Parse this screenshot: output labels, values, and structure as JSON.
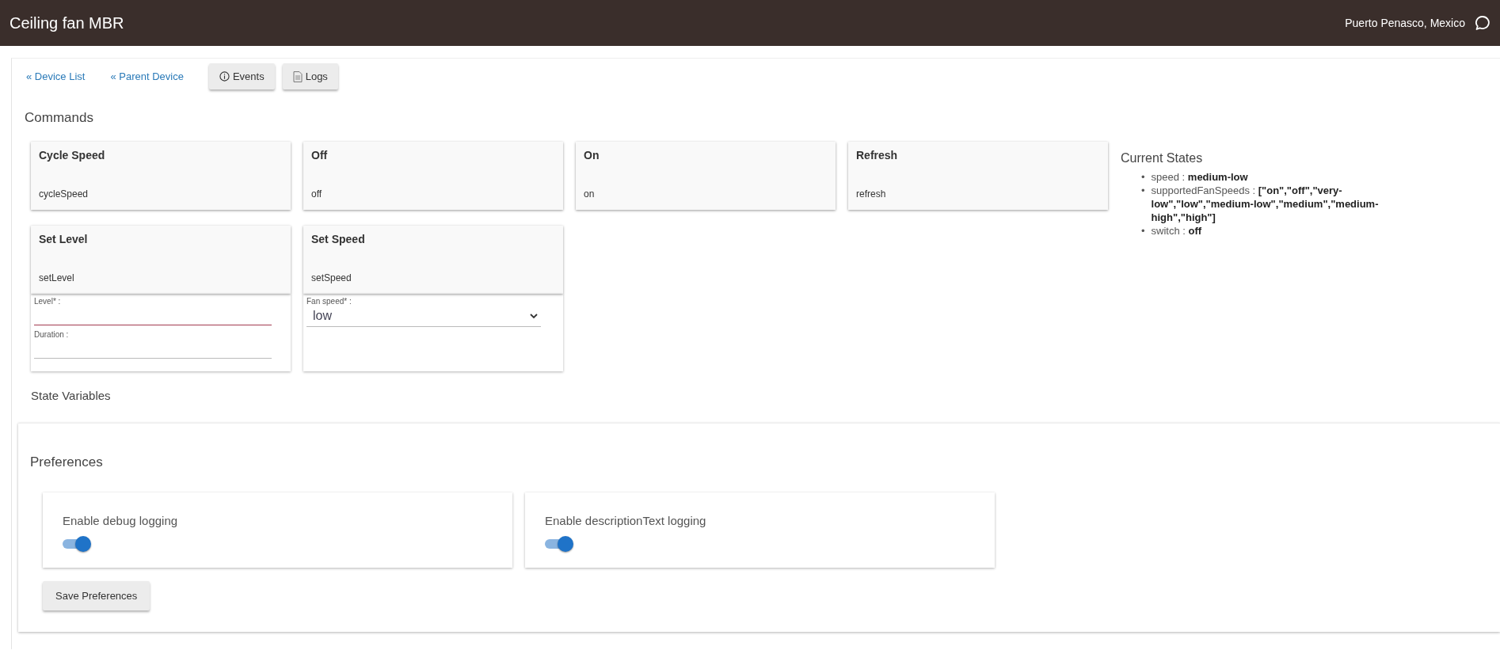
{
  "header": {
    "title": "Ceiling fan MBR",
    "location": "Puerto Penasco, Mexico"
  },
  "nav": {
    "links": [
      "« Device List",
      "« Parent Device"
    ],
    "buttons": [
      {
        "kind": "events",
        "label": "Events"
      },
      {
        "kind": "logs",
        "label": "Logs"
      }
    ]
  },
  "commands": {
    "title": "Commands",
    "items": [
      {
        "title": "Cycle Speed",
        "method": "cycleSpeed"
      },
      {
        "title": "Off",
        "method": "off"
      },
      {
        "title": "On",
        "method": "on"
      },
      {
        "title": "Refresh",
        "method": "refresh"
      },
      {
        "title": "Set Level",
        "method": "setLevel",
        "inputs": [
          {
            "kind": "text",
            "label": "Level* :",
            "invalid": true
          },
          {
            "kind": "text",
            "label": "Duration :",
            "invalid": false
          }
        ]
      },
      {
        "title": "Set Speed",
        "method": "setSpeed",
        "inputs": [
          {
            "kind": "select",
            "label": "Fan speed* :",
            "value": "low"
          }
        ]
      }
    ]
  },
  "current_states": {
    "title": "Current States",
    "items": [
      {
        "bullet": "•",
        "name": "speed : ",
        "value": "medium-low"
      },
      {
        "bullet": "•",
        "name": "supportedFanSpeeds : ",
        "value": "[\"on\",\"off\",\"very-low\",\"low\",\"medium-low\",\"medium\",\"medium-high\",\"high\"]"
      },
      {
        "bullet": "•",
        "name": "switch : ",
        "value": "off"
      }
    ]
  },
  "state_variables": {
    "title": "State Variables"
  },
  "preferences": {
    "title": "Preferences",
    "items": [
      {
        "label": "Enable debug logging",
        "on": true
      },
      {
        "label": "Enable descriptionText logging",
        "on": true
      }
    ],
    "save_button": "Save Preferences"
  }
}
